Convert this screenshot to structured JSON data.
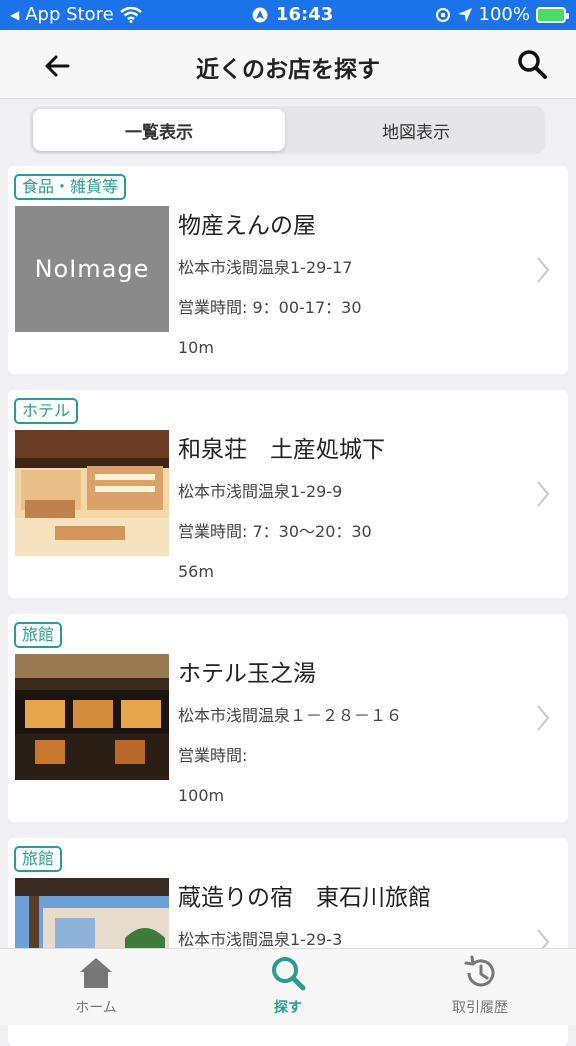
{
  "status_bar": {
    "carrier": "App Store",
    "time": "16:43",
    "battery": "100%"
  },
  "header": {
    "title": "近くのお店を探す"
  },
  "segment": {
    "list_label": "一覧表示",
    "map_label": "地図表示"
  },
  "shops": [
    {
      "category": "食品・雑貨等",
      "name": "物産えんの屋",
      "address": "松本市浅間温泉1-29-17",
      "hours": "営業時間: 9：00-17：30",
      "distance": "10m",
      "image_placeholder": "NoImage"
    },
    {
      "category": "ホテル",
      "name": "和泉荘　土産処城下",
      "address": "松本市浅間温泉1-29-9",
      "hours": "営業時間: 7：30～20：30",
      "distance": "56m"
    },
    {
      "category": "旅館",
      "name": "ホテル玉之湯",
      "address": "松本市浅間温泉１－２８－１６",
      "hours": "営業時間:",
      "distance": "100m"
    },
    {
      "category": "旅館",
      "name": "蔵造りの宿　東石川旅館",
      "address": "松本市浅間温泉1-29-3"
    }
  ],
  "tabbar": {
    "home": "ホーム",
    "search": "探す",
    "history": "取引履歴"
  },
  "colors": {
    "accent": "#2a9d8f",
    "status_bar": "#1a73e8"
  }
}
